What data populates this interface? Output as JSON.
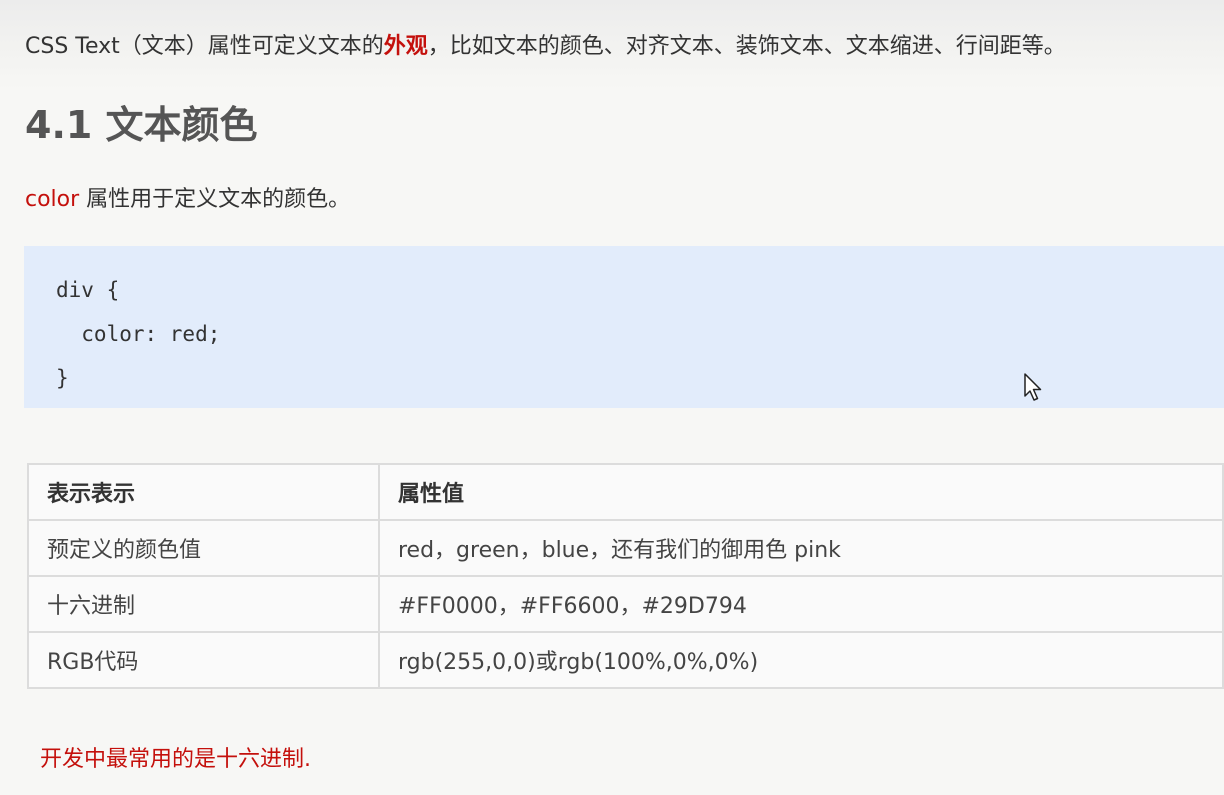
{
  "intro": {
    "before": "CSS Text（文本）属性可定义文本的",
    "emphasis": "外观",
    "after": "，比如文本的颜色、对齐文本、装饰文本、文本缩进、行间距等。"
  },
  "section_heading": "4.1 文本颜色",
  "description": {
    "keyword": "color",
    "text": " 属性用于定义文本的颜色。"
  },
  "code": {
    "line1": "div {",
    "line2": "  color: red;",
    "line3": "}"
  },
  "table": {
    "headers": [
      "表示表示",
      "属性值"
    ],
    "rows": [
      [
        "预定义的颜色值",
        "red，green，blue，还有我们的御用色 pink"
      ],
      [
        "十六进制",
        "#FF0000，#FF6600，#29D794"
      ],
      [
        "RGB代码",
        "rgb(255,0,0)或rgb(100%,0%,0%)"
      ]
    ]
  },
  "note": "开发中最常用的是十六进制.",
  "colors": {
    "accent_red": "#c4100c",
    "code_background": "#e2ecfb",
    "heading_gray": "#555555"
  },
  "icons": {
    "cursor": "mouse-pointer-icon"
  }
}
